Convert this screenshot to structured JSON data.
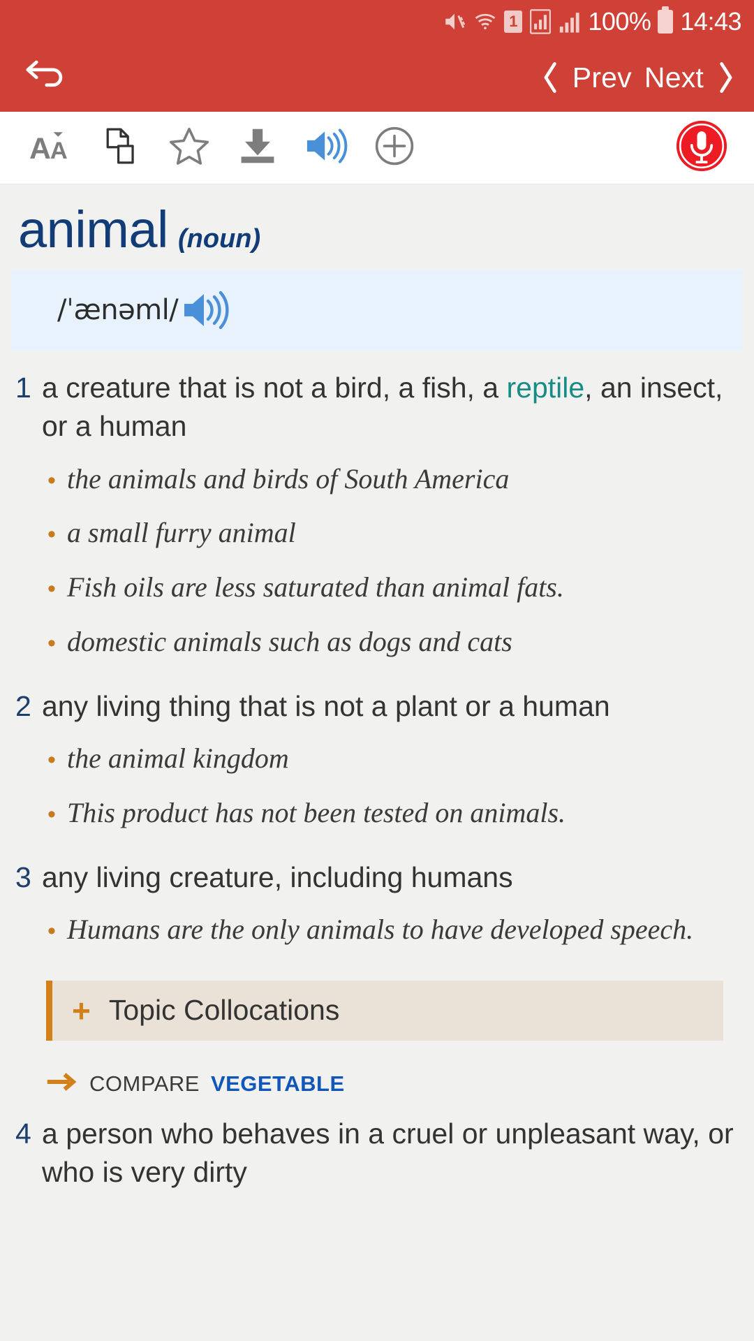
{
  "statusbar": {
    "icons": [
      "mute-icon",
      "wifi-icon",
      "sim-icon",
      "signal-box-icon",
      "signal-bars-icon"
    ],
    "sim_label": "1",
    "battery_percent": "100%",
    "time": "14:43"
  },
  "appbar": {
    "back_icon": "back-arrow-icon",
    "prev_label": "Prev",
    "next_label": "Next",
    "background_color": "#cf4037"
  },
  "toolbar": {
    "items": [
      {
        "name": "font-size-icon",
        "label": "AĂ"
      },
      {
        "name": "copy-page-icon",
        "label": ""
      },
      {
        "name": "favorite-star-icon",
        "label": ""
      },
      {
        "name": "download-icon",
        "label": ""
      },
      {
        "name": "speaker-icon",
        "label": ""
      },
      {
        "name": "add-circle-icon",
        "label": ""
      }
    ],
    "mic_label": "microphone-icon",
    "accent_color": "#ed1c24"
  },
  "entry": {
    "headword": "animal",
    "part_of_speech": "(noun)",
    "headword_color": "#123c78",
    "pronunciation": "/ˈænəml/",
    "pronunciation_icon": "speaker-icon",
    "senses": [
      {
        "number": "1",
        "definition_before": "a creature that is not a bird, a fish, a ",
        "xref": "reptile",
        "definition_after": ", an insect, or a human",
        "examples": [
          "the animals and birds of South America",
          "a small furry animal",
          "Fish oils are less saturated than animal fats.",
          "domestic animals such as dogs and cats"
        ]
      },
      {
        "number": "2",
        "definition_before": "any living thing that is not a plant or a human",
        "xref": "",
        "definition_after": "",
        "examples": [
          "the animal kingdom",
          "This product has not been tested on animals."
        ]
      },
      {
        "number": "3",
        "definition_before": "any living creature, including humans",
        "xref": "",
        "definition_after": "",
        "examples": [
          "Humans are the only animals to have developed speech."
        ]
      },
      {
        "number": "4",
        "definition_before": "a person who behaves in a cruel or unpleasant way, or who is very dirty",
        "xref": "",
        "definition_after": "",
        "examples": []
      }
    ],
    "collocations": {
      "expand_icon": "plus-icon",
      "label": "Topic Collocations",
      "accent_color": "#d2801a"
    },
    "compare": {
      "arrow_icon": "arrow-right-icon",
      "label": "COMPARE",
      "target": "VEGETABLE",
      "target_color": "#1157bb"
    }
  }
}
